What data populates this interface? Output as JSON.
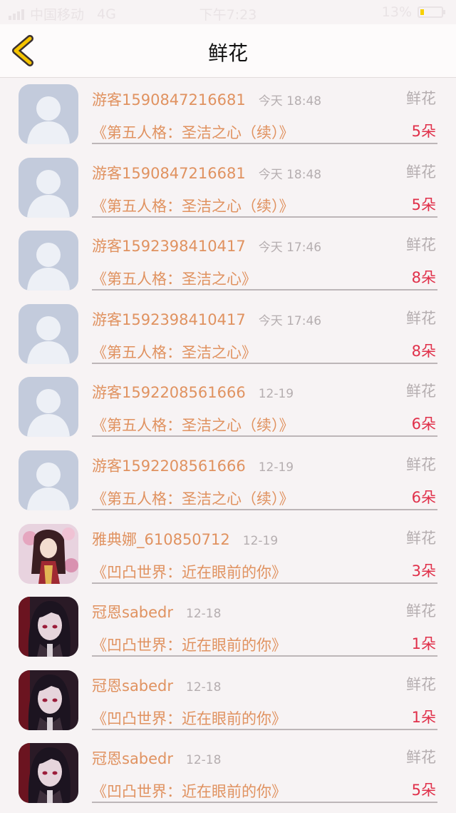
{
  "status_bar": {
    "carrier": "中国移动",
    "network": "4G",
    "time": "下午7:23",
    "battery": "13%"
  },
  "header": {
    "title": "鲜花",
    "back_icon": "chevron-left-icon"
  },
  "colors": {
    "accent": "#e09260",
    "count": "#e0304a",
    "muted": "#b5aeb0",
    "back": "#f5c400"
  },
  "records": [
    {
      "user": "游客1590847216681",
      "time": "今天 18:48",
      "type": "鲜花",
      "book": "《第五人格：圣洁之心（续）》",
      "count": "5朵",
      "avatar": "default"
    },
    {
      "user": "游客1590847216681",
      "time": "今天 18:48",
      "type": "鲜花",
      "book": "《第五人格：圣洁之心（续）》",
      "count": "5朵",
      "avatar": "default"
    },
    {
      "user": "游客1592398410417",
      "time": "今天 17:46",
      "type": "鲜花",
      "book": "《第五人格：圣洁之心》",
      "count": "8朵",
      "avatar": "default"
    },
    {
      "user": "游客1592398410417",
      "time": "今天 17:46",
      "type": "鲜花",
      "book": "《第五人格：圣洁之心》",
      "count": "8朵",
      "avatar": "default"
    },
    {
      "user": "游客1592208561666",
      "time": "12-19",
      "type": "鲜花",
      "book": "《第五人格：圣洁之心（续）》",
      "count": "6朵",
      "avatar": "default"
    },
    {
      "user": "游客1592208561666",
      "time": "12-19",
      "type": "鲜花",
      "book": "《第五人格：圣洁之心（续）》",
      "count": "6朵",
      "avatar": "default"
    },
    {
      "user": "雅典娜_610850712",
      "time": "12-19",
      "type": "鲜花",
      "book": "《凹凸世界：近在眼前的你》",
      "count": "3朵",
      "avatar": "anime-girl"
    },
    {
      "user": "冠恩sabedr",
      "time": "12-18",
      "type": "鲜花",
      "book": "《凹凸世界：近在眼前的你》",
      "count": "1朵",
      "avatar": "anime-boy"
    },
    {
      "user": "冠恩sabedr",
      "time": "12-18",
      "type": "鲜花",
      "book": "《凹凸世界：近在眼前的你》",
      "count": "1朵",
      "avatar": "anime-boy"
    },
    {
      "user": "冠恩sabedr",
      "time": "12-18",
      "type": "鲜花",
      "book": "《凹凸世界：近在眼前的你》",
      "count": "5朵",
      "avatar": "anime-boy"
    }
  ]
}
